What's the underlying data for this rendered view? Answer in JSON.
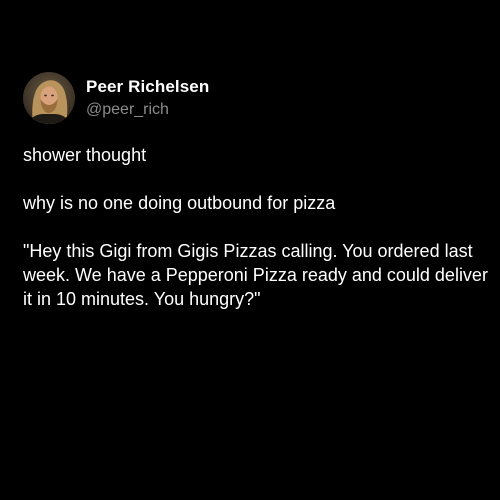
{
  "author": {
    "name": "Peer Richelsen",
    "handle": "@peer_rich",
    "avatar_icon": "profile-avatar-icon"
  },
  "tweet": {
    "paragraphs": [
      "shower thought",
      "why is no one doing outbound for pizza",
      "\"Hey this Gigi from Gigis Pizzas calling. You ordered last week. We have a Pepperoni Pizza ready and could deliver it in 10 minutes. You hungry?\""
    ]
  },
  "colors": {
    "background": "#000000",
    "text": "#ffffff",
    "handle": "#8b8b8b"
  }
}
